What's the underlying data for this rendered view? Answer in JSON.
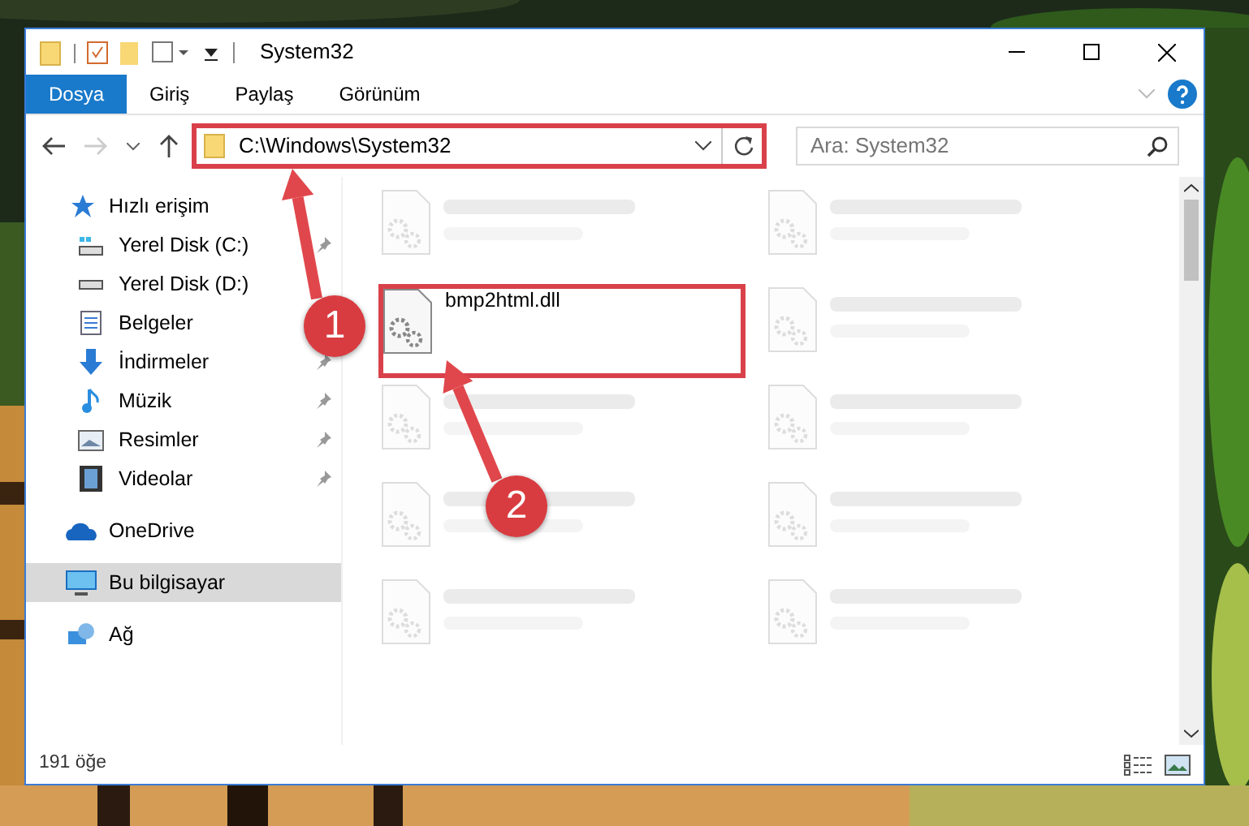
{
  "window": {
    "title": "System32"
  },
  "ribbon_tabs": [
    {
      "label": "Dosya",
      "selected": true
    },
    {
      "label": "Giriş",
      "selected": false
    },
    {
      "label": "Paylaş",
      "selected": false
    },
    {
      "label": "Görünüm",
      "selected": false
    }
  ],
  "address": {
    "path": "C:\\Windows\\System32",
    "highlighted": true
  },
  "search": {
    "placeholder": "Ara: System32"
  },
  "nav": [
    {
      "label": "Hızlı erişim",
      "kind": "star",
      "selected": false,
      "pinned": false,
      "children": [
        {
          "label": "Yerel Disk (C:)",
          "kind": "drive-c",
          "selected": false,
          "pinned": true
        },
        {
          "label": "Yerel Disk (D:)",
          "kind": "drive",
          "selected": false,
          "pinned": false
        },
        {
          "label": "Belgeler",
          "kind": "docs",
          "selected": false,
          "pinned": false
        },
        {
          "label": "İndirmeler",
          "kind": "download",
          "selected": false,
          "pinned": true
        },
        {
          "label": "Müzik",
          "kind": "music",
          "selected": false,
          "pinned": true
        },
        {
          "label": "Resimler",
          "kind": "pictures",
          "selected": false,
          "pinned": true
        },
        {
          "label": "Videolar",
          "kind": "video",
          "selected": false,
          "pinned": true
        }
      ]
    },
    {
      "label": "OneDrive",
      "kind": "cloud",
      "selected": false,
      "pinned": false
    },
    {
      "label": "Bu bilgisayar",
      "kind": "pc",
      "selected": true,
      "pinned": false
    },
    {
      "label": "Ağ",
      "kind": "network",
      "selected": false,
      "pinned": false
    }
  ],
  "files": [
    {
      "blurred": true,
      "selected": false
    },
    {
      "blurred": true,
      "selected": false
    },
    {
      "name": "bmp2html.dll",
      "blurred": false,
      "selected": true
    },
    {
      "blurred": true,
      "selected": false
    },
    {
      "blurred": true,
      "selected": false
    },
    {
      "blurred": true,
      "selected": false
    },
    {
      "blurred": true,
      "selected": false
    },
    {
      "blurred": true,
      "selected": false
    },
    {
      "blurred": true,
      "selected": false
    },
    {
      "blurred": true,
      "selected": false
    }
  ],
  "status_bar": {
    "count": "191 öğe"
  },
  "annotations": [
    {
      "number": "1"
    },
    {
      "number": "2"
    }
  ]
}
